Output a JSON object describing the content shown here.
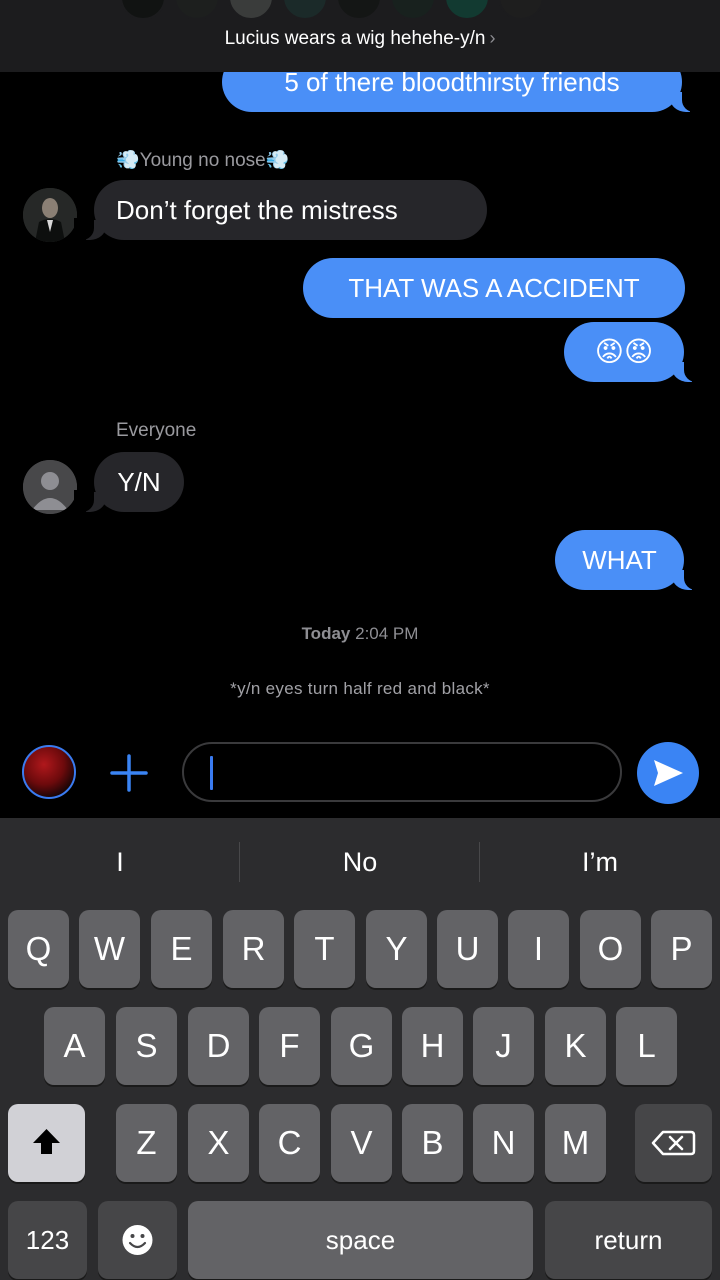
{
  "header": {
    "title": "Lucius wears a wig hehehe-y/n",
    "chevron": "›"
  },
  "messages": {
    "m1": "5 of there bloodthirsty friends",
    "m2_sender": "💨Young no nose💨",
    "m2": "Don’t forget the mistress",
    "m3": "THAT WAS A ACCIDENT",
    "m4": "😡😡",
    "m5_sender": "Everyone",
    "m5": "Y/N",
    "m6": "WHAT"
  },
  "timestamp": {
    "day": "Today",
    "time": "2:04 PM"
  },
  "system_note": "*y/n eyes turn half red and black*",
  "input": {
    "value": "",
    "placeholder": ""
  },
  "keyboard": {
    "suggestions": [
      "I",
      "No",
      "I’m"
    ],
    "row1": [
      "Q",
      "W",
      "E",
      "R",
      "T",
      "Y",
      "U",
      "I",
      "O",
      "P"
    ],
    "row2": [
      "A",
      "S",
      "D",
      "F",
      "G",
      "H",
      "J",
      "K",
      "L"
    ],
    "row3": [
      "Z",
      "X",
      "C",
      "V",
      "B",
      "N",
      "M"
    ],
    "numbers_label": "123",
    "space_label": "space",
    "return_label": "return"
  },
  "colors": {
    "outgoing_bubble": "#4a8ff7",
    "incoming_bubble": "#26262a",
    "accent": "#3a84f4",
    "background": "#000000"
  },
  "icons": {
    "plus": "plus-icon",
    "send": "send-arrow-icon",
    "shift": "shift-arrow-icon",
    "backspace": "backspace-icon",
    "emoji": "emoji-icon",
    "default_avatar": "person-silhouette-icon"
  }
}
